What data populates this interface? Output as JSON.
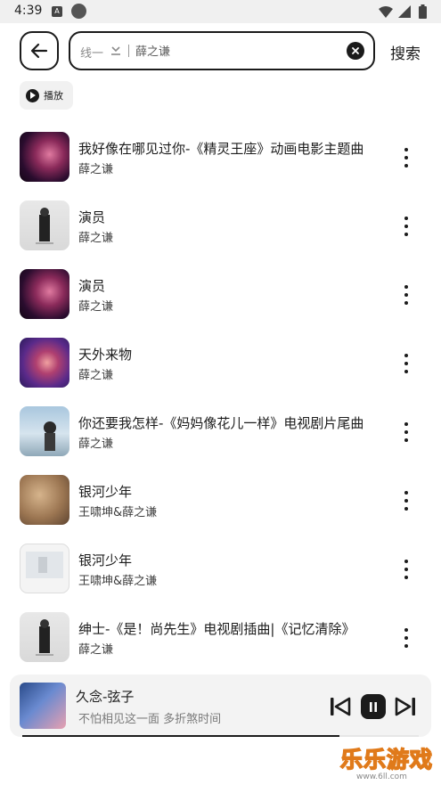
{
  "status_bar": {
    "time": "4:39",
    "notification_label": "A"
  },
  "header": {
    "back_icon": "arrow-left-icon",
    "route_label": "线一",
    "route_icon": "download-icon",
    "search_query": "薛之谦",
    "clear_icon": "close-circle-icon",
    "search_button_label": "搜索"
  },
  "play_chip": {
    "icon": "play-circle-icon",
    "label": "播放"
  },
  "songs": [
    {
      "title": "我好像在哪见过你-《精灵王座》动画电影主题曲",
      "artist": "薛之谦",
      "cover": "cover-red"
    },
    {
      "title": "演员",
      "artist": "薛之谦",
      "cover": "cover-suit"
    },
    {
      "title": "演员",
      "artist": "薛之谦",
      "cover": "cover-red"
    },
    {
      "title": "天外来物",
      "artist": "薛之谦",
      "cover": "cover-purple"
    },
    {
      "title": "你还要我怎样-《妈妈像花儿一样》电视剧片尾曲",
      "artist": "薛之谦",
      "cover": "cover-sky"
    },
    {
      "title": "银河少年",
      "artist": "王啸坤&薛之谦",
      "cover": "cover-brown"
    },
    {
      "title": "银河少年",
      "artist": "王啸坤&薛之谦",
      "cover": "cover-white"
    },
    {
      "title": "绅士-《是！尚先生》电视剧插曲|《记忆清除》",
      "artist": "薛之谦",
      "cover": "cover-suit"
    }
  ],
  "now_playing": {
    "title": "久念-弦子",
    "lyric": "不怕相见这一面 多折煞时间",
    "progress": 0.8,
    "prev_icon": "skip-previous-icon",
    "pause_icon": "pause-icon",
    "next_icon": "skip-next-icon"
  },
  "watermark": {
    "text": "乐乐游戏",
    "url": "www.6ll.com"
  },
  "colors": {
    "primary": "#1b1b1b",
    "muted": "#8a8a8a",
    "watermark_orange": "#e07a1a"
  }
}
